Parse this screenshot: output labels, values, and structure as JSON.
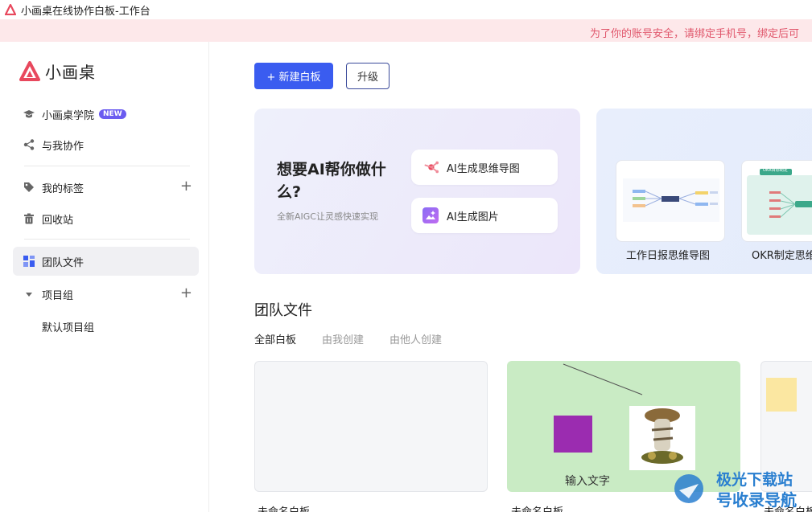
{
  "window": {
    "title": "小画桌在线协作白板-工作台"
  },
  "banner": {
    "text": "为了你的账号安全，请绑定手机号，绑定后可"
  },
  "brand": {
    "name": "小画桌"
  },
  "sidebar": {
    "items": [
      {
        "label": "小画桌学院",
        "badge": "NEW",
        "icon": "graduation-cap-icon"
      },
      {
        "label": "与我协作",
        "icon": "share-icon"
      },
      {
        "label": "我的标签",
        "icon": "tag-icon"
      },
      {
        "label": "回收站",
        "icon": "trash-icon"
      },
      {
        "label": "团队文件",
        "icon": "grid-icon"
      },
      {
        "label": "项目组",
        "icon": "caret-down-icon"
      },
      {
        "label": "默认项目组"
      }
    ]
  },
  "toolbar": {
    "new_board": "+ 新建白板",
    "upgrade": "升级"
  },
  "ai": {
    "title": "想要AI帮你做什么?",
    "subtitle": "全新AIGC让灵感快速实现",
    "options": [
      {
        "label": "AI生成思维导图",
        "icon": "mindmap-ai-icon"
      },
      {
        "label": "AI生成图片",
        "icon": "image-ai-icon"
      }
    ]
  },
  "templates": [
    {
      "label": "工作日报思维导图"
    },
    {
      "label": "OKR制定思维导图",
      "thumb_text": "OKR目标制定"
    }
  ],
  "section": {
    "title": "团队文件",
    "tabs": [
      {
        "label": "全部白板",
        "active": true
      },
      {
        "label": "由我创建",
        "active": false
      },
      {
        "label": "由他人创建",
        "active": false
      }
    ]
  },
  "boards": [
    {
      "label": "未命名白板",
      "bg": "#f5f6f8"
    },
    {
      "label": "未命名白板",
      "bg": "#c9ebc4",
      "text": "输入文字"
    },
    {
      "label": "未命名白板",
      "bg": "#f5f6f8"
    }
  ],
  "watermark": {
    "line1": "极光下载站",
    "line2": "号收录导航"
  },
  "colors": {
    "accent": "#3a5cf0",
    "brand": "#e8485d",
    "banner_bg": "#fde8ea"
  }
}
